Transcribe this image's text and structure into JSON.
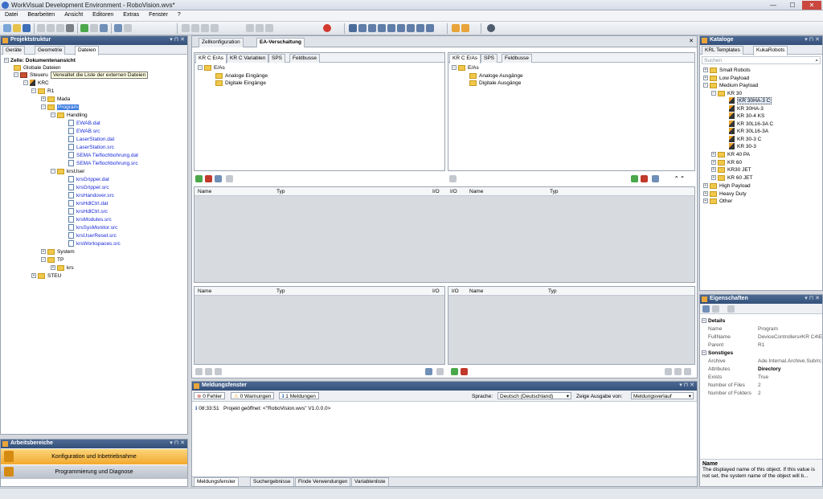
{
  "window": {
    "title": "WorkVisual Development Environment - RoboVision.wvs*",
    "min": "—",
    "max": "☐",
    "close": "✕"
  },
  "menu": [
    "Datei",
    "Bearbeiten",
    "Ansicht",
    "Editoren",
    "Extras",
    "Fenster",
    "?"
  ],
  "projekt": {
    "title": "Projektstruktur",
    "pin": "▾ ⊓ ✕",
    "tabs": [
      "Geräte",
      "Geometrie",
      "Dateien"
    ],
    "tree": {
      "cell": "Zelle: Dokumentenansicht",
      "globale": "Globale Dateien",
      "steuerung": "Steueru",
      "tooltip": "Verwaltet die Liste der externen Dateien",
      "krc": "KRC",
      "r1": "R1",
      "mada": "Mada",
      "program": "Program",
      "handling": "Handling",
      "handling_files": [
        "EWAB.dat",
        "EWAB.src",
        "LaserStation.dat",
        "LaserStation.src",
        "SEMA Tieflochbohrung.dat",
        "SEMA Tieflochbohrung.src"
      ],
      "krsuser": "krsUser",
      "krsuser_files": [
        "krsGripper.dat",
        "krsGripper.src",
        "krsHandover.src",
        "krsHdlCtrl.dat",
        "krsHdlCtrl.src",
        "krsModules.src",
        "krsSysMonitor.src",
        "krsUserReset.src",
        "krsWorkspaces.src"
      ],
      "system": "System",
      "tp": "TP",
      "krs": "krs",
      "steu": "STEU"
    }
  },
  "arbeitsbereiche": {
    "title": "Arbeitsbereiche",
    "items": [
      "Konfiguration und Inbetriebnahme",
      "Programmierung und Diagnose"
    ]
  },
  "editor": {
    "tabs": [
      "Zellkonfiguration",
      "EA-Verschaltung"
    ],
    "close": "✕",
    "left_tabs": [
      "KR C E/As",
      "KR C Variablen",
      "SPS",
      "Feldbusse"
    ],
    "right_tabs": [
      "KR C E/As",
      "SPS",
      "Feldbusse"
    ],
    "left_tree": {
      "root": "E/As",
      "items": [
        "Analoge Eingänge",
        "Digitale Eingänge"
      ]
    },
    "right_tree": {
      "root": "E/As",
      "items": [
        "Analoge Ausgänge",
        "Digitale Ausgänge"
      ]
    },
    "grid_top": {
      "name": "Name",
      "typ": "Typ",
      "io": "I/O"
    },
    "grid_bottom": {
      "name": "Name",
      "typ": "Typ",
      "io": "I/O"
    }
  },
  "meldung": {
    "title": "Meldungsfenster",
    "fehler": "0 Fehler",
    "warnungen": "0 Warnungen",
    "meldungen": "1 Meldungen",
    "sprache_label": "Sprache:",
    "sprache": "Deutsch (Deutschland)",
    "zeige_label": "Zeige Ausgabe von:",
    "zeige": "Meldungsverlauf",
    "time": "08:33:51",
    "msg": "Projekt geöffnet: <\"RoboVision.wvs\" V1.0.0.0>",
    "bottom_tabs": [
      "Meldungsfenster",
      "Suchergebnisse",
      "Finde Verwendungen",
      "Variablenliste"
    ]
  },
  "kataloge": {
    "title": "Kataloge",
    "tabs": [
      "KRL Templates",
      "KukaRobots"
    ],
    "search": "Suchen",
    "items": [
      "Small Robots",
      "Low Payload",
      "Medium Payload",
      "KR 30",
      "KR 30HA-3 C",
      "KR 30HA-3",
      "KR 30-4 KS",
      "KR 30L16-3A C",
      "KR 30L16-3A",
      "KR 30-3 C",
      "KR 30-3",
      "KR 40 PA",
      "KR 60",
      "KR30 JET",
      "KR 60 JET",
      "High Payload",
      "Heavy Duty",
      "Other"
    ]
  },
  "eigenschaften": {
    "title": "Eigenschaften",
    "sections": [
      "Details",
      "Sonstiges"
    ],
    "rows": [
      [
        "Name",
        "Program"
      ],
      [
        "FullName",
        "DeviceControllers#KR C4\\E"
      ],
      [
        "Parent",
        "R1"
      ],
      [
        "Archive",
        "Ade.Internal.Archive.Sub/rc"
      ],
      [
        "Attributes",
        "Directory"
      ],
      [
        "Exists",
        "True"
      ],
      [
        "Number of Files",
        "2"
      ],
      [
        "Number of Folders",
        "2"
      ]
    ],
    "desc_title": "Name",
    "desc": "The displayed name of this object. If this value is not set, the system name of the object will b..."
  }
}
